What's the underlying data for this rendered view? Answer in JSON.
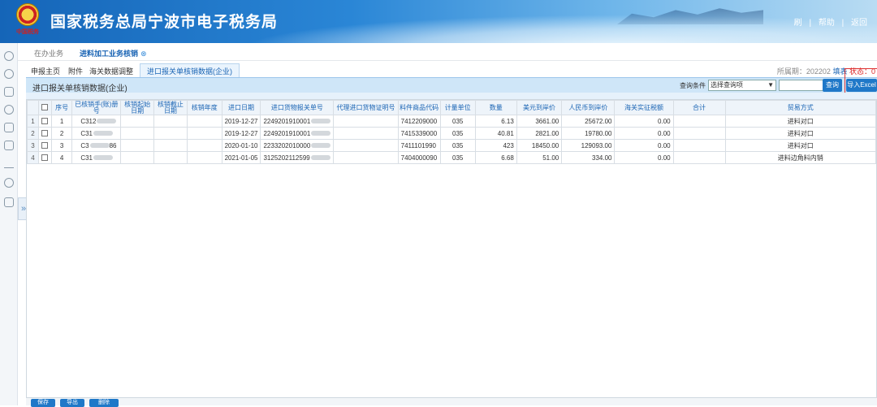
{
  "header": {
    "title": "国家税务总局宁波市电子税务局",
    "emblem_caption": "中国税务",
    "links": [
      "刷",
      "|",
      "帮助",
      "|",
      "返回"
    ]
  },
  "task_tabs": [
    {
      "label": "在办业务"
    },
    {
      "label": "进料加工业务核销",
      "close": "⊗"
    }
  ],
  "sub_tabs": [
    {
      "label": "申报主页"
    },
    {
      "label": "附件"
    },
    {
      "label": "海关数据调整"
    },
    {
      "label": "进口报关单核销数据(企业)"
    }
  ],
  "period": {
    "label": "所属期：202202",
    "fill": "填表",
    "status": "状态：0"
  },
  "panel": {
    "title": "进口报关单核销数据(企业)",
    "query_condition_label": "查询条件",
    "select_placeholder": "选择查询项",
    "query_button": "查询",
    "import_button": "导入Excel"
  },
  "table": {
    "columns": [
      "序号",
      "已核销手(账)册号",
      "核销起始日期",
      "核销截止日期",
      "核销年度",
      "进口日期",
      "进口货物报关单号",
      "代理进口货物证明号",
      "料件商品代码",
      "计量单位",
      "数量",
      "美元到岸价",
      "人民币到岸价",
      "海关实征税额",
      "合计",
      "贸易方式"
    ],
    "rows": [
      {
        "rn": "1",
        "seq": "1",
        "manual": "C312",
        "start": "",
        "end": "",
        "year": "",
        "date": "2019-12-27",
        "decl": "2249201910001",
        "agent": "",
        "code": "7412209000",
        "unit": "035",
        "qty": "6.13",
        "usd": "3661.00",
        "cny": "25672.00",
        "tax": "0.00",
        "total": "",
        "trade": "进料对口"
      },
      {
        "rn": "2",
        "seq": "2",
        "manual": "C31",
        "start": "",
        "end": "",
        "year": "",
        "date": "2019-12-27",
        "decl": "2249201910001",
        "agent": "",
        "code": "7415339000",
        "unit": "035",
        "qty": "40.81",
        "usd": "2821.00",
        "cny": "19780.00",
        "tax": "0.00",
        "total": "",
        "trade": "进料对口"
      },
      {
        "rn": "3",
        "seq": "3",
        "manual": "C3",
        "manual_tail": "86",
        "start": "",
        "end": "",
        "year": "",
        "date": "2020-01-10",
        "decl": "2233202010000",
        "agent": "",
        "code": "7411101990",
        "unit": "035",
        "qty": "423",
        "usd": "18450.00",
        "cny": "129093.00",
        "tax": "0.00",
        "total": "",
        "trade": "进料对口"
      },
      {
        "rn": "4",
        "seq": "4",
        "manual": "C31",
        "start": "",
        "end": "",
        "year": "",
        "date": "2021-01-05",
        "decl": "3125202112599",
        "agent": "",
        "code": "7404000090",
        "unit": "035",
        "qty": "6.68",
        "usd": "51.00",
        "cny": "334.00",
        "tax": "0.00",
        "total": "",
        "trade": "进料边角料内销"
      }
    ]
  },
  "bottom": {
    "buttons": [
      "保存",
      "导出",
      "删除"
    ]
  }
}
